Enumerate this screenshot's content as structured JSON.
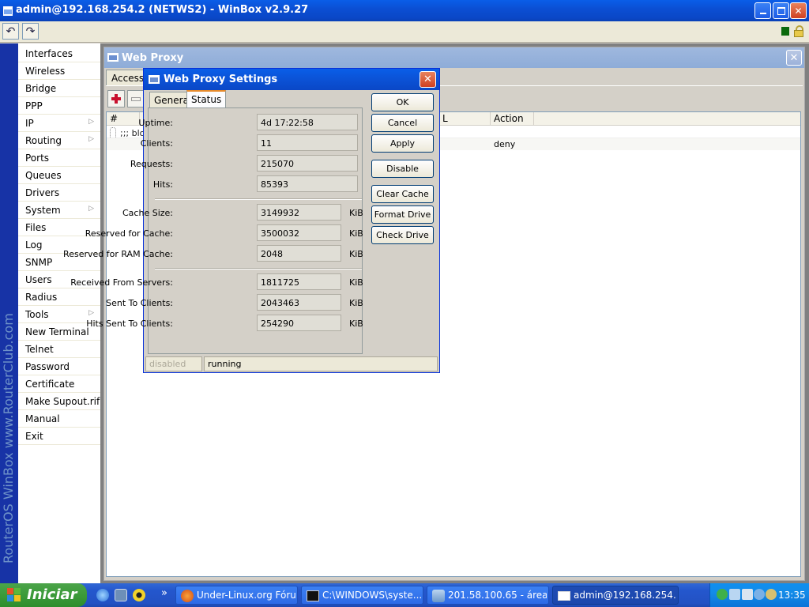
{
  "app": {
    "title": "admin@192.168.254.2 (NETWS2) - WinBox v2.9.27",
    "brand": "RouterOS WinBox   www.RouterClub.com"
  },
  "toolbar": {
    "undo": "↶",
    "redo": "↷"
  },
  "menu": {
    "items": [
      {
        "label": "Interfaces",
        "sub": false
      },
      {
        "label": "Wireless",
        "sub": false
      },
      {
        "label": "Bridge",
        "sub": false
      },
      {
        "label": "PPP",
        "sub": false
      },
      {
        "label": "IP",
        "sub": true
      },
      {
        "label": "Routing",
        "sub": true
      },
      {
        "label": "Ports",
        "sub": false
      },
      {
        "label": "Queues",
        "sub": false
      },
      {
        "label": "Drivers",
        "sub": false
      },
      {
        "label": "System",
        "sub": true
      },
      {
        "label": "Files",
        "sub": false
      },
      {
        "label": "Log",
        "sub": false
      },
      {
        "label": "SNMP",
        "sub": false
      },
      {
        "label": "Users",
        "sub": false
      },
      {
        "label": "Radius",
        "sub": false
      },
      {
        "label": "Tools",
        "sub": true
      },
      {
        "label": "New Terminal",
        "sub": false
      },
      {
        "label": "Telnet",
        "sub": false
      },
      {
        "label": "Password",
        "sub": false
      },
      {
        "label": "Certificate",
        "sub": false
      },
      {
        "label": "Make Supout.rif",
        "sub": false
      },
      {
        "label": "Manual",
        "sub": false
      },
      {
        "label": "Exit",
        "sub": false
      }
    ],
    "submenu_glyph": "▷"
  },
  "web_proxy": {
    "title": "Web Proxy",
    "tab": "Access",
    "columns": {
      "num": "#",
      "url": "L",
      "action": "Action"
    },
    "rows": [
      {
        "comment": ";;; bloc",
        "action": "deny"
      }
    ]
  },
  "dialog": {
    "title": "Web Proxy Settings",
    "tabs": [
      "General",
      "Status"
    ],
    "active_tab": "Status",
    "fields": {
      "uptime": {
        "label": "Uptime:",
        "value": "4d 17:22:58"
      },
      "clients": {
        "label": "Clients:",
        "value": "11"
      },
      "requests": {
        "label": "Requests:",
        "value": "215070"
      },
      "hits": {
        "label": "Hits:",
        "value": "85393"
      },
      "cache_size": {
        "label": "Cache Size:",
        "value": "3149932",
        "unit": "KiB"
      },
      "reserved_cache": {
        "label": "Reserved for Cache:",
        "value": "3500032",
        "unit": "KiB"
      },
      "reserved_ram": {
        "label": "Reserved for RAM Cache:",
        "value": "2048",
        "unit": "KiB"
      },
      "received": {
        "label": "Received From Servers:",
        "value": "1811725",
        "unit": "KiB"
      },
      "sent": {
        "label": "Sent To Clients:",
        "value": "2043463",
        "unit": "KiB"
      },
      "hits_sent": {
        "label": "Hits Sent To Clients:",
        "value": "254290",
        "unit": "KiB"
      }
    },
    "buttons": {
      "ok": "OK",
      "cancel": "Cancel",
      "apply": "Apply",
      "disable": "Disable",
      "clear_cache": "Clear Cache",
      "format_drive": "Format Drive",
      "check_drive": "Check Drive"
    },
    "status": {
      "left": "disabled",
      "right": "running"
    }
  },
  "taskbar": {
    "start": "Iniciar",
    "more": "»",
    "tasks": [
      {
        "label": "Under-Linux.org Fóru...",
        "icon": "firefox-icon",
        "active": false
      },
      {
        "label": "C:\\WINDOWS\\syste...",
        "icon": "cmd-icon",
        "active": false
      },
      {
        "label": "201.58.100.65 - área...",
        "icon": "network-icon",
        "active": false
      },
      {
        "label": "admin@192.168.254....",
        "icon": "winbox-icon",
        "active": true
      }
    ],
    "clock": "13:35"
  },
  "colors": {
    "xp_blue": "#0a5ee8",
    "start_green": "#3b9a39",
    "brand_bar": "#1733a6",
    "tab_highlight": "#e68b2c"
  }
}
